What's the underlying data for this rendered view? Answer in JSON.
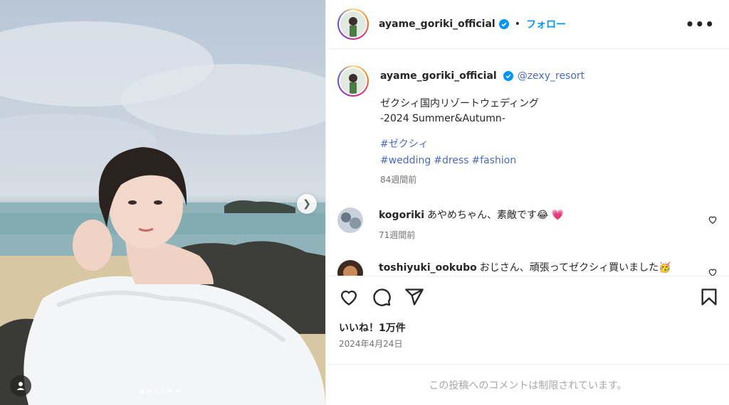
{
  "post": {
    "username": "ayame_goriki_official",
    "follow_label": "フォロー",
    "separator": "•",
    "more_label": "•••",
    "mention": "@zexy_resort",
    "caption_text": "ゼクシィ国内リゾートウェディング\n-2024 Summer&Autumn-",
    "hashtags": [
      "#ゼクシィ",
      "#wedding",
      "#dress",
      "#fashion"
    ],
    "caption_time": "84週間前",
    "likes_label": "いいね！1万件",
    "date": "2024年4月24日",
    "restricted_notice": "この投稿へのコメントは制限されています。"
  },
  "comments": [
    {
      "username": "kogoriki",
      "text": "あやめちゃん、素敵です😂 💗",
      "time": "71週間前"
    },
    {
      "username": "toshiyuki_ookubo",
      "text": "おじさん、頑張ってゼクシィ買いました🥳",
      "time": ""
    }
  ],
  "carousel": {
    "slide_count": 6,
    "active_index": 0
  },
  "icons": {
    "like": "heart-icon",
    "comment": "comment-icon",
    "share": "send-icon",
    "save": "bookmark-icon",
    "verified": "verified-badge-icon",
    "next": "chevron-right-icon",
    "tag": "user-tag-icon"
  },
  "colors": {
    "accent": "#0095f6",
    "link": "#4b6bbf",
    "verified": "#0095f6"
  }
}
